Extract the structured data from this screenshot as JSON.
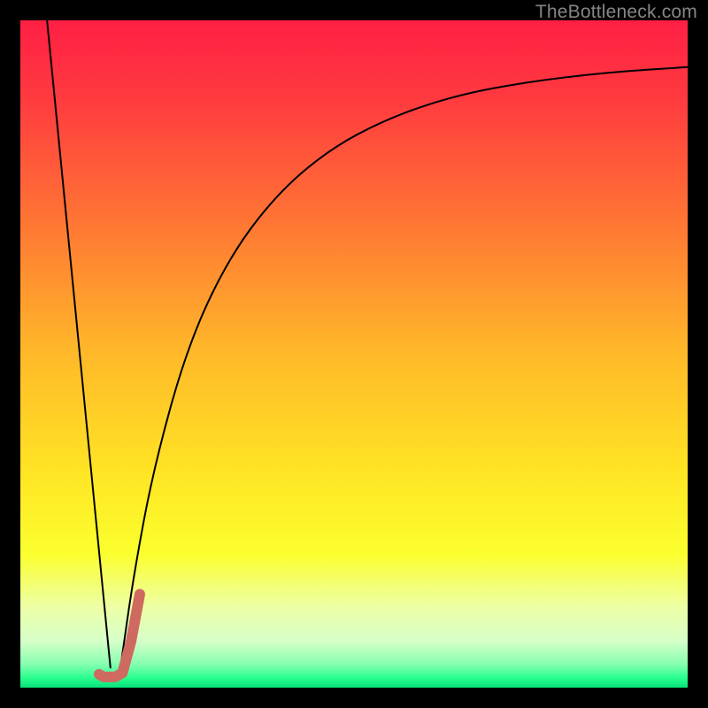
{
  "watermark": "TheBottleneck.com",
  "chart_data": {
    "type": "line",
    "title": "",
    "xlabel": "",
    "ylabel": "",
    "xlim": [
      0,
      100
    ],
    "ylim": [
      0,
      100
    ],
    "gradient_stops": [
      {
        "offset": 0.0,
        "color": "#ff1f44"
      },
      {
        "offset": 0.12,
        "color": "#ff3b3f"
      },
      {
        "offset": 0.3,
        "color": "#ff7534"
      },
      {
        "offset": 0.5,
        "color": "#ffb929"
      },
      {
        "offset": 0.68,
        "color": "#ffe524"
      },
      {
        "offset": 0.8,
        "color": "#fbff2e"
      },
      {
        "offset": 0.88,
        "color": "#edffa7"
      },
      {
        "offset": 0.93,
        "color": "#d6ffc8"
      },
      {
        "offset": 0.965,
        "color": "#86ffb0"
      },
      {
        "offset": 0.985,
        "color": "#2aff8f"
      },
      {
        "offset": 1.0,
        "color": "#06e27a"
      }
    ],
    "series": [
      {
        "name": "left-descent",
        "stroke": "#000000",
        "width": 2,
        "points": [
          {
            "x": 4.0,
            "y": 100.0
          },
          {
            "x": 13.5,
            "y": 3.0
          }
        ]
      },
      {
        "name": "right-rise",
        "stroke": "#000000",
        "width": 2,
        "points": [
          {
            "x": 15.0,
            "y": 3.0
          },
          {
            "x": 17.0,
            "y": 17.0
          },
          {
            "x": 20.0,
            "y": 33.0
          },
          {
            "x": 25.0,
            "y": 51.0
          },
          {
            "x": 31.0,
            "y": 64.0
          },
          {
            "x": 38.0,
            "y": 73.5
          },
          {
            "x": 46.0,
            "y": 80.5
          },
          {
            "x": 55.0,
            "y": 85.3
          },
          {
            "x": 65.0,
            "y": 88.7
          },
          {
            "x": 76.0,
            "y": 90.8
          },
          {
            "x": 88.0,
            "y": 92.2
          },
          {
            "x": 100.0,
            "y": 93.0
          }
        ]
      },
      {
        "name": "j-mark",
        "stroke": "#cf6a61",
        "width": 12,
        "points": [
          {
            "x": 11.8,
            "y": 2.0
          },
          {
            "x": 12.5,
            "y": 1.6
          },
          {
            "x": 14.2,
            "y": 1.6
          },
          {
            "x": 15.3,
            "y": 2.2
          },
          {
            "x": 16.6,
            "y": 7.0
          },
          {
            "x": 17.9,
            "y": 14.0
          }
        ]
      }
    ],
    "grid": false,
    "legend": false
  }
}
